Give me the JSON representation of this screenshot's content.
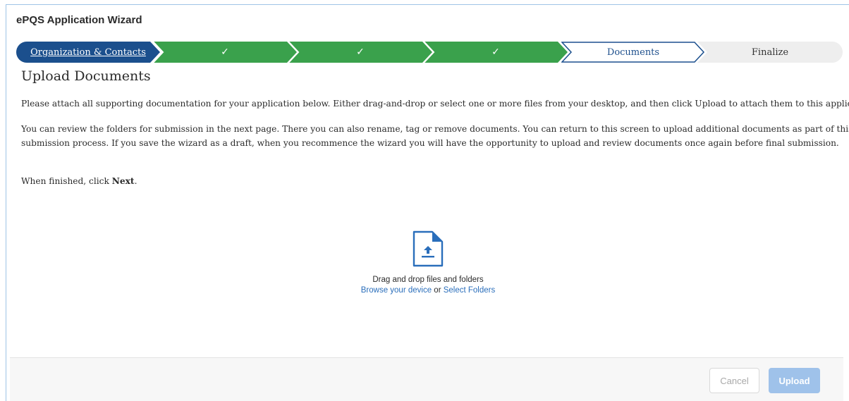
{
  "app": {
    "title": "ePQS Application Wizard"
  },
  "stepper": {
    "steps": [
      {
        "label": "Organization & Contacts",
        "state": "current-link",
        "color": "#1b4f8d"
      },
      {
        "label": "✓",
        "state": "complete",
        "color": "#3aa14c"
      },
      {
        "label": "✓",
        "state": "complete",
        "color": "#3aa14c"
      },
      {
        "label": "✓",
        "state": "complete",
        "color": "#3aa14c"
      },
      {
        "label": "Documents",
        "state": "active",
        "color": "#ffffff"
      },
      {
        "label": "Finalize",
        "state": "pending",
        "color": "#eeeeee"
      }
    ]
  },
  "main": {
    "heading": "Upload Documents",
    "paragraph1": "Please attach all supporting documentation for your application below. Either drag-and-drop or select one or more files from your desktop, and then click Upload to attach them to this application.",
    "paragraph2_line1": "You can review the folders for submission in the next page. There you can also rename, tag or remove documents. You can return to this screen to upload additional documents as part of this",
    "paragraph2_line2": "submission process. If you save the wizard as a draft, when you recommence the wizard you will have the opportunity to upload and review documents once again before final submission.",
    "finish_prefix": "When finished, click ",
    "finish_bold": "Next",
    "finish_suffix": "."
  },
  "dropzone": {
    "icon": "file-upload-icon",
    "instruction": "Drag and drop files and folders",
    "browse_label": "Browse your device",
    "or_label": " or ",
    "folders_label": "Select Folders"
  },
  "footer": {
    "cancel_label": "Cancel",
    "upload_label": "Upload"
  },
  "colors": {
    "accent_blue": "#1b4f8d",
    "complete_green": "#3aa14c",
    "link_blue": "#2a6ebb",
    "disabled_upload": "#9fc2ea"
  }
}
